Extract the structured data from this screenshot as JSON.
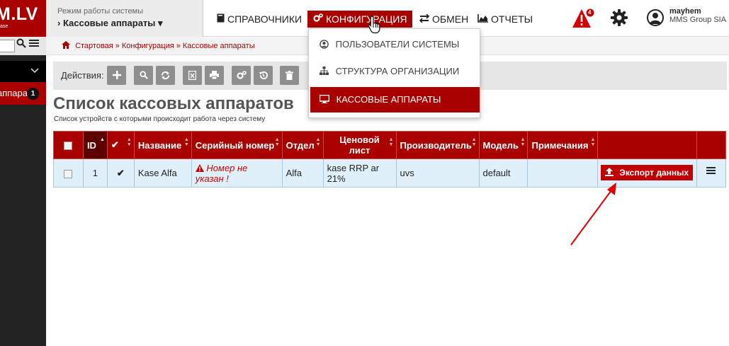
{
  "logo": {
    "text": "M.LV",
    "sub": "ase"
  },
  "sidebar": {
    "item_label": "аппараты",
    "item_badge": "1"
  },
  "mode": {
    "caption": "Режим работы системы",
    "value": "› Кассовые аппараты ▾"
  },
  "nav": {
    "items": [
      {
        "icon": "book-icon",
        "label": "СПРАВОЧНИКИ"
      },
      {
        "icon": "cogs-icon",
        "label": "КОНФИГУРАЦИЯ"
      },
      {
        "icon": "exchange-icon",
        "label": "ОБМЕН"
      },
      {
        "icon": "chart-icon",
        "label": "ОТЧЕТЫ"
      }
    ]
  },
  "alert": {
    "count": "4"
  },
  "user": {
    "name": "mayhem",
    "org": "MMS Group SIA"
  },
  "breadcrumb": [
    "Стартовая",
    "Конфигурация",
    "Кассовые аппараты"
  ],
  "actions": {
    "label": "Действия:"
  },
  "page": {
    "title": "Список кассовых аппаратов",
    "subtitle": "Список устройств с которыми происходит работа через систему"
  },
  "table": {
    "columns": [
      "ID",
      "✔",
      "Название",
      "Серийный номер",
      "Отдел",
      "Ценовой лист",
      "Производитель",
      "Модель",
      "Примечания"
    ],
    "rows": [
      {
        "id": "1",
        "active": "✔",
        "name": "Kase Alfa",
        "serial": "Номер не указан !",
        "department": "Alfa",
        "price_list": "kase RRP ar 21%",
        "manufacturer": "uvs",
        "model": "default",
        "notes": "",
        "export_label": "Экспорт данных"
      }
    ]
  },
  "dropdown": {
    "items": [
      {
        "icon": "user-circle-icon",
        "label": "ПОЛЬЗОВАТЕЛИ СИСТЕМЫ"
      },
      {
        "icon": "sitemap-icon",
        "label": "СТРУКТУРА ОРГАНИЗАЦИИ"
      },
      {
        "icon": "monitor-icon",
        "label": "КАССОВЫЕ АППАРАТЫ"
      }
    ]
  },
  "colors": {
    "brand": "#a90000",
    "sidebar": "#222222",
    "row": "#dff0fb"
  }
}
